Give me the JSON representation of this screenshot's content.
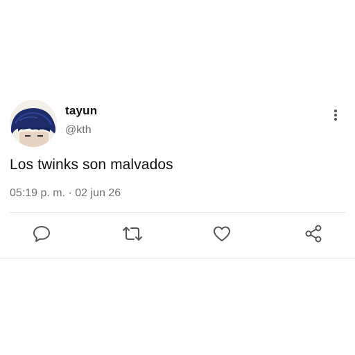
{
  "tweet": {
    "author_name": "tayun",
    "author_handle": "@kth",
    "text": "Los twinks son malvados",
    "time": "05:19 p. m.",
    "separator": "·",
    "date": "02 jun 26"
  },
  "icons": {
    "more": "more-vertical-icon",
    "reply": "comment-icon",
    "retweet": "retweet-icon",
    "like": "heart-icon",
    "share": "share-icon"
  },
  "colors": {
    "text_primary": "#111111",
    "text_secondary": "#6b6b6b",
    "icon": "#555555",
    "divider": "#e6e6e6",
    "avatar_hair": "#1f2f6e"
  }
}
